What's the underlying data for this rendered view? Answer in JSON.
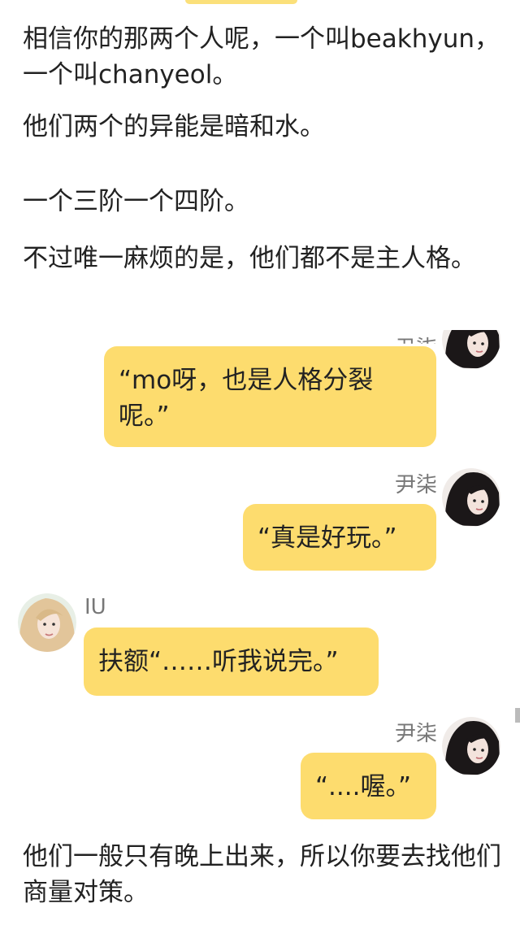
{
  "story": {
    "line_1": "相信你的那两个人呢，一个叫beakhyun，一个叫chanyeol。",
    "line_2": "他们两个的异能是暗和水。",
    "line_3": "一个三阶一个四阶。",
    "line_4": "不过唯一麻烦的是，他们都不是主人格。",
    "line_5": "他们一般只有晚上出来，所以你要去找他们商量对策。"
  },
  "messages": [
    {
      "speaker": "尹柒",
      "side": "right",
      "text": "“mo呀，也是人格分裂呢。”",
      "avatar_icon": "dark-hair-girl-avatar"
    },
    {
      "speaker": "尹柒",
      "side": "right",
      "text": "“真是好玩。”",
      "avatar_icon": "dark-hair-girl-avatar"
    },
    {
      "speaker": "IU",
      "side": "left",
      "text": "扶额“……听我说完。”",
      "avatar_icon": "blonde-girl-avatar"
    },
    {
      "speaker": "尹柒",
      "side": "right",
      "text": "“....喔。”",
      "avatar_icon": "dark-hair-girl-avatar"
    }
  ],
  "colors": {
    "bubble": "#fddc6e",
    "speaker_name": "#777777",
    "text": "#222222"
  }
}
